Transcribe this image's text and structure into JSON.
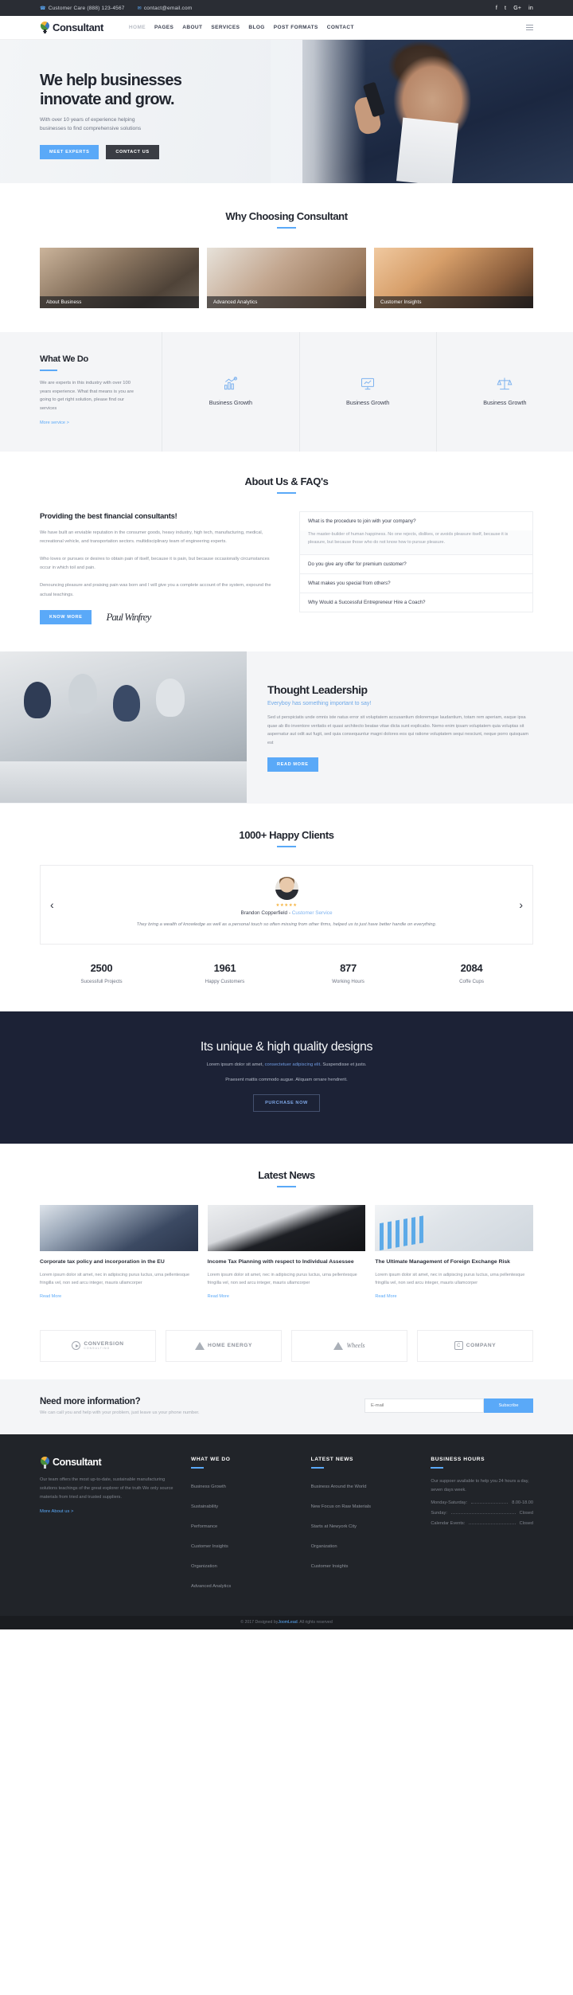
{
  "topbar": {
    "phone": "Customer Care (888) 123-4567",
    "email": "contact@email.com",
    "socials": [
      "f",
      "t",
      "G+",
      "in"
    ]
  },
  "nav": {
    "brand": "Consultant",
    "items": [
      {
        "label": "HOME",
        "active": true
      },
      {
        "label": "PAGES",
        "active": false
      },
      {
        "label": "ABOUT",
        "active": false
      },
      {
        "label": "SERVICES",
        "active": false
      },
      {
        "label": "BLOG",
        "active": false
      },
      {
        "label": "POST FORMATS",
        "active": false
      },
      {
        "label": "CONTACT",
        "active": false
      }
    ]
  },
  "hero": {
    "title_line1": "We help businesses",
    "title_line2": "innovate and grow.",
    "subtitle": "With over 10 years of experience helping businesses to find comprehensive solutions",
    "btn_primary": "MEET EXPERTS",
    "btn_secondary": "CONTACT US"
  },
  "why": {
    "title": "Why Choosing Consultant",
    "cards": [
      {
        "caption": "About Business"
      },
      {
        "caption": "Advanced Analytics"
      },
      {
        "caption": "Customer Insights"
      }
    ]
  },
  "what_we_do": {
    "title": "What We Do",
    "copy": "We are experts in this industry with over 100 years experience. What that means is you are going to get right solution, please find our services",
    "more_link": "More service >",
    "services": [
      {
        "name": "Business Growth"
      },
      {
        "name": "Business Growth"
      },
      {
        "name": "Business Growth"
      }
    ]
  },
  "faq": {
    "title": "About Us & FAQ's",
    "left_heading": "Providing the best financial consultants!",
    "paragraphs": [
      "We have built an enviable reputation in the consumer goods, heavy industry, high tech, manufacturing, medical, recreational vehicle, and transportation sectors. multidisciplinary team of engineering experts.",
      "Who loves or pursues or desires to obtain pain of itself, because it is pain, but because occasionally circumstances occur in which toil and pain.",
      "Denouncing pleasure and praising pain was born and I will give you a complete account of the system, expound the actual teachings."
    ],
    "know_more": "KNOW MORE",
    "signature": "Paul Winfrey",
    "items": [
      {
        "q": "What is the procedure to join with your company?",
        "a": "The master-builder of human happiness. No one rejects, dislikes, or avoids pleasure itself, because it is pleasure, but because those who do not know how to pursue pleasure.",
        "open": true
      },
      {
        "q": "Do you give any offer for premium customer?",
        "a": "",
        "open": false
      },
      {
        "q": "What makes you special from others?",
        "a": "",
        "open": false
      },
      {
        "q": "Why Would a Successful Entrepreneur Hire a Coach?",
        "a": "",
        "open": false
      }
    ]
  },
  "thought": {
    "title": "Thought Leadership",
    "tagline": "Everyboy has something important to say!",
    "body": "Sed ut perspiciatis unde omnis iste natus error sit voluptatem accusantium doloremque laudantium, totam rem aperiam, eaque ipsa quae ab illo inventore veritatis et quasi architecto beatae vitae dicta sunt explicabo. Nemo enim ipsam voluptatem quia voluptas sit aspernatur aut odit aut fugit, sed quia consequuntur magni dolores eos qui ratione voluptatem sequi nesciunt, neque porro quisquam est",
    "button": "READ MORE"
  },
  "testimonials": {
    "title": "1000+ Happy Clients",
    "stars": "★★★★★",
    "author": "Brandon Copperfield",
    "role": "Customer Service",
    "quote": "They bring a wealth of knowledge as well as a personal touch so often missing from other firms, helped us to just have better handle on everything.",
    "prev": "‹",
    "next": "›",
    "stats": [
      {
        "number": "2500",
        "label": "Sucessfull Projects"
      },
      {
        "number": "1961",
        "label": "Happy Customers"
      },
      {
        "number": "877",
        "label": "Working Hours"
      },
      {
        "number": "2084",
        "label": "Coffe Cups"
      }
    ]
  },
  "cta": {
    "title": "Its unique & high quality designs",
    "line1_a": "Lorem ipsum dolor sit amet, ",
    "line1_link": "consectetuer adipiscing elit",
    "line1_b": ". Suspendisse et justo.",
    "line2": "Praesent mattis commodo augue. Aliquam ornare hendrerit.",
    "button": "PURCHASE NOW"
  },
  "news": {
    "title": "Latest News",
    "items": [
      {
        "title": "Corporate tax policy and incorporation in the EU",
        "excerpt": "Lorem ipsum dolor sit amet, nec in adipiscing purus luctus, urna pellentesque fringilla vel, non sed arcu integer, mauris ullamcorper",
        "link": "Read More"
      },
      {
        "title": "Income Tax Planning with respect to Individual Assessee",
        "excerpt": "Lorem ipsum dolor sit amet, nec in adipiscing purus luctus, urna pellentesque fringilla vel, non sed arcu integer, mauris ullamcorper",
        "link": "Read More"
      },
      {
        "title": "The Ultimate Management of Foreign Exchange Risk",
        "excerpt": "Lorem ipsum dolor sit amet, nec in adipiscing purus luctus, urna pellentesque fringilla vel, non sed arcu integer, mauris ullamcorper",
        "link": "Read More"
      }
    ]
  },
  "clients": [
    {
      "name": "CONVERSION",
      "sub": "CONSULTING"
    },
    {
      "name": "HOME ENERGY",
      "sub": ""
    },
    {
      "name": "Wheels",
      "sub": ""
    },
    {
      "name": "COMPANY",
      "sub": ""
    }
  ],
  "newsletter": {
    "heading": "Need more information?",
    "sub": "We can call you and help with your problem, just leave us your phone number.",
    "placeholder": "E-mail",
    "button": "Subscribe"
  },
  "footer": {
    "brand": "Consultant",
    "about": "Our team offers the most up-to-date, sustainable manufacturing solutions teachings of the great explorer of the truth We only source materials from tried and trusted suppliers.",
    "more_about": "More About us >",
    "col2": {
      "title": "WHAT WE DO",
      "links": [
        "Business Growth",
        "Sustainability",
        "Performance",
        "Customer Insights",
        "Organization",
        "Advanced Analytics"
      ]
    },
    "col3": {
      "title": "LATEST NEWS",
      "links": [
        "Business Around the World",
        "New Focus on Raw Materials",
        "Starts at Newyork City",
        "Organization",
        "Customer Insights"
      ]
    },
    "col4": {
      "title": "BUSINESS HOURS",
      "intro": "Our suppoer available to help you 24 hours a day, seven days week.",
      "rows": [
        {
          "label": "Monday-Saturday:",
          "value": "8.00-18.00"
        },
        {
          "label": "Sunday:",
          "value": "Closed"
        },
        {
          "label": "Calendar Events:",
          "value": "Closed"
        }
      ]
    },
    "copyright_a": "© 2017 Designed by ",
    "copyright_link": "JoomLead",
    "copyright_b": ". All rights reserved"
  }
}
